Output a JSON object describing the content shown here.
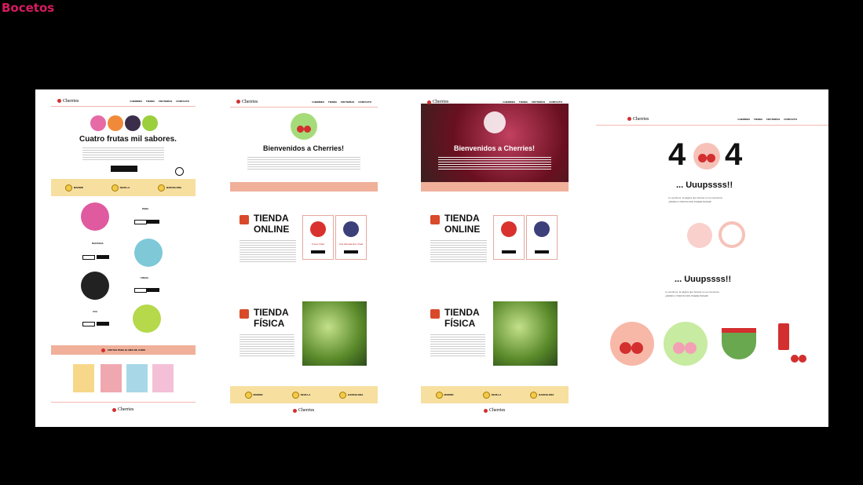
{
  "page_title": "Bocetos",
  "colors": {
    "accent": "#d81b60",
    "pink_band": "#f0b09a",
    "yellow_band": "#f7dfa0"
  },
  "brand": "Cherries",
  "nav": [
    "CHERRIES",
    "TIENDA",
    "FRUTERÍAS",
    "CONTACTO"
  ],
  "mock1": {
    "headline": "Cuatro frutas mil sabores.",
    "stores": [
      "MADRID",
      "SEVILLA",
      "BARCELONA"
    ],
    "fruits": [
      "PERA",
      "NARANJA",
      "FRESA",
      "UVA"
    ],
    "banner": "FRUTAS PARA EL MES DE JUNIO"
  },
  "mock2": {
    "welcome": "Bienvenidos a Cherries!",
    "online_a": "TIENDA",
    "online_b": "ONLINE",
    "fisica_a": "TIENDA",
    "fisica_b": "FÍSICA",
    "product1": "Fresa Chad",
    "product2": "Uva Morada Eco Chad",
    "stores": [
      "MADRID",
      "SEVILLA",
      "BARCELONA"
    ]
  },
  "mock3": {
    "welcome": "Bienvenidos a Cherries!",
    "online_a": "TIENDA",
    "online_b": "ONLINE",
    "fisica_a": "TIENDA",
    "fisica_b": "FÍSICA",
    "stores": [
      "MADRID",
      "SEVILLA",
      "BARCELONA"
    ]
  },
  "mock4": {
    "code_a": "4",
    "code_b": "4",
    "oops1": "... Uuupssss!!",
    "msg1a": "Lo sentimos, la página que buscas no se encuentra.",
    "msg1b": "¡ÁNIMO A TODOS NOS PUEDE PASAR!",
    "oops2": "... Uuupssss!!",
    "msg2a": "Lo sentimos, la página que buscas no se encuentra.",
    "msg2b": "¡ÁNIMO A TODOS NOS PUEDE PASAR!"
  }
}
